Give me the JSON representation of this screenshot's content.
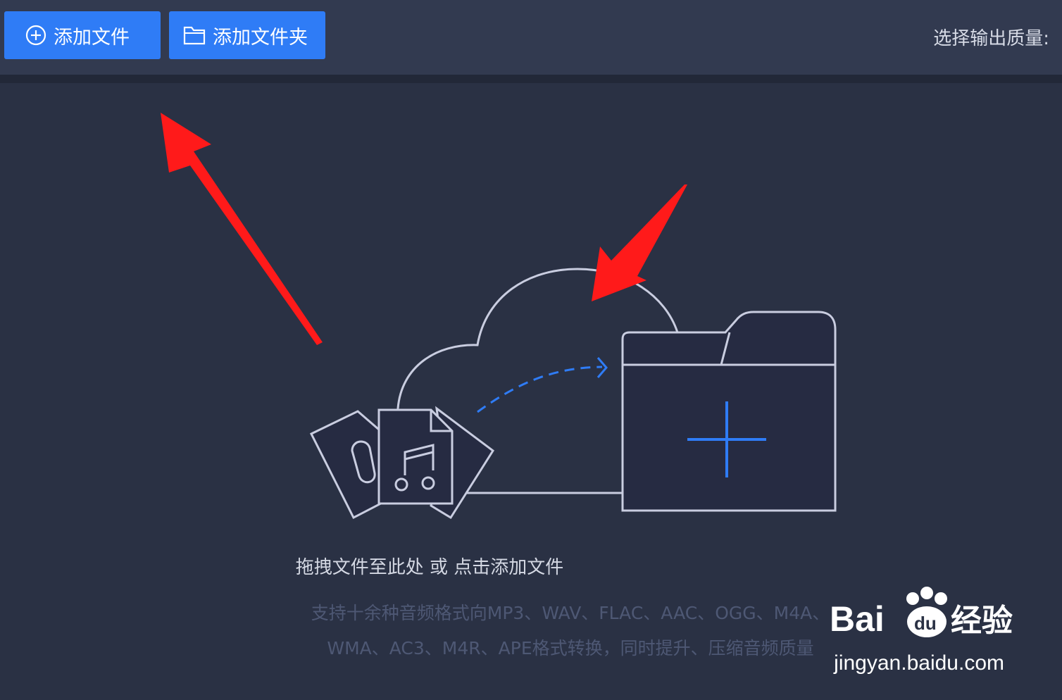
{
  "toolbar": {
    "add_file_label": "添加文件",
    "add_folder_label": "添加文件夹",
    "quality_label": "选择输出质量:"
  },
  "drop_zone": {
    "hint": "拖拽文件至此处 或 点击添加文件",
    "formats_line1": "支持十余种音频格式向MP3、WAV、FLAC、AAC、OGG、M4A、",
    "formats_line2": "WMA、AC3、M4R、APE格式转换，同时提升、压缩音频质量"
  },
  "watermark": {
    "brand": "Bai du 经验",
    "url": "jingyan.baidu.com"
  },
  "colors": {
    "accent": "#2f7cf6",
    "background": "#2a3144",
    "toolbar": "#323a50",
    "annotation_arrow": "#ff1a1a"
  },
  "icons": [
    "plus-circle-icon",
    "folder-icon",
    "cloud-icon",
    "audio-files-icon",
    "folder-plus-icon",
    "red-arrow-annotation"
  ]
}
